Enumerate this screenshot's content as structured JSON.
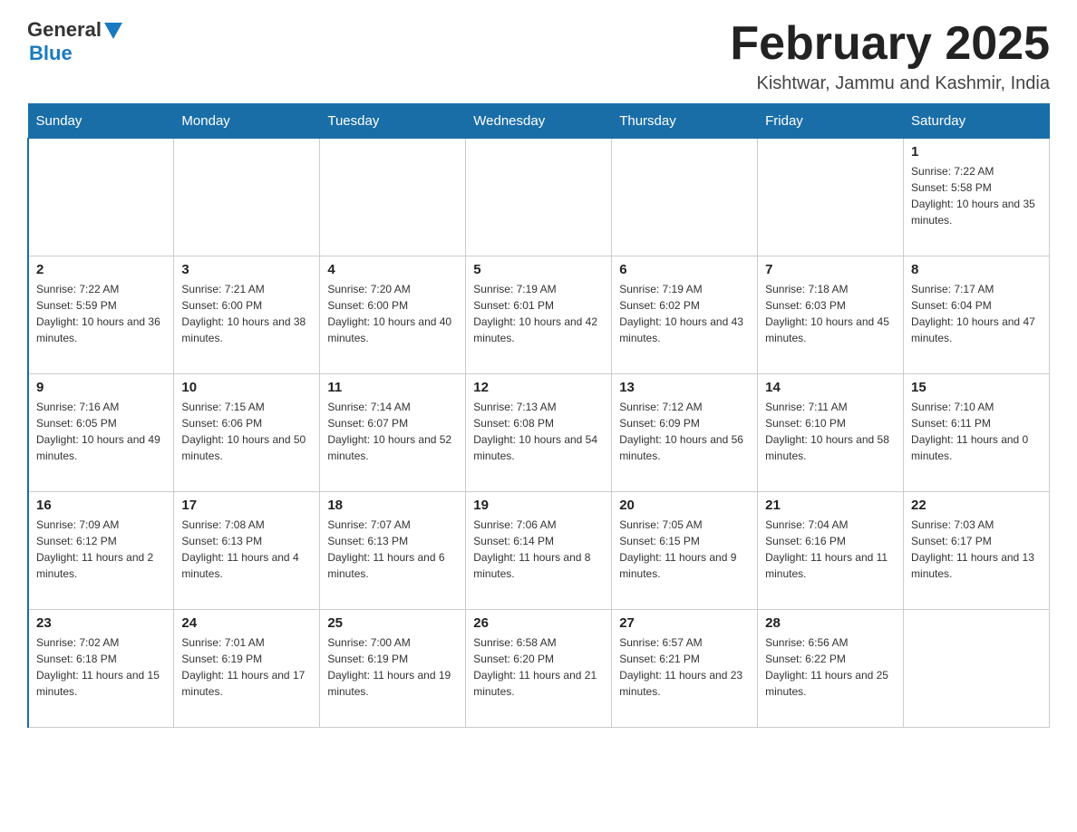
{
  "logo": {
    "general": "General",
    "blue": "Blue"
  },
  "title": "February 2025",
  "location": "Kishtwar, Jammu and Kashmir, India",
  "days_of_week": [
    "Sunday",
    "Monday",
    "Tuesday",
    "Wednesday",
    "Thursday",
    "Friday",
    "Saturday"
  ],
  "weeks": [
    [
      {
        "day": "",
        "info": ""
      },
      {
        "day": "",
        "info": ""
      },
      {
        "day": "",
        "info": ""
      },
      {
        "day": "",
        "info": ""
      },
      {
        "day": "",
        "info": ""
      },
      {
        "day": "",
        "info": ""
      },
      {
        "day": "1",
        "info": "Sunrise: 7:22 AM\nSunset: 5:58 PM\nDaylight: 10 hours and 35 minutes."
      }
    ],
    [
      {
        "day": "2",
        "info": "Sunrise: 7:22 AM\nSunset: 5:59 PM\nDaylight: 10 hours and 36 minutes."
      },
      {
        "day": "3",
        "info": "Sunrise: 7:21 AM\nSunset: 6:00 PM\nDaylight: 10 hours and 38 minutes."
      },
      {
        "day": "4",
        "info": "Sunrise: 7:20 AM\nSunset: 6:00 PM\nDaylight: 10 hours and 40 minutes."
      },
      {
        "day": "5",
        "info": "Sunrise: 7:19 AM\nSunset: 6:01 PM\nDaylight: 10 hours and 42 minutes."
      },
      {
        "day": "6",
        "info": "Sunrise: 7:19 AM\nSunset: 6:02 PM\nDaylight: 10 hours and 43 minutes."
      },
      {
        "day": "7",
        "info": "Sunrise: 7:18 AM\nSunset: 6:03 PM\nDaylight: 10 hours and 45 minutes."
      },
      {
        "day": "8",
        "info": "Sunrise: 7:17 AM\nSunset: 6:04 PM\nDaylight: 10 hours and 47 minutes."
      }
    ],
    [
      {
        "day": "9",
        "info": "Sunrise: 7:16 AM\nSunset: 6:05 PM\nDaylight: 10 hours and 49 minutes."
      },
      {
        "day": "10",
        "info": "Sunrise: 7:15 AM\nSunset: 6:06 PM\nDaylight: 10 hours and 50 minutes."
      },
      {
        "day": "11",
        "info": "Sunrise: 7:14 AM\nSunset: 6:07 PM\nDaylight: 10 hours and 52 minutes."
      },
      {
        "day": "12",
        "info": "Sunrise: 7:13 AM\nSunset: 6:08 PM\nDaylight: 10 hours and 54 minutes."
      },
      {
        "day": "13",
        "info": "Sunrise: 7:12 AM\nSunset: 6:09 PM\nDaylight: 10 hours and 56 minutes."
      },
      {
        "day": "14",
        "info": "Sunrise: 7:11 AM\nSunset: 6:10 PM\nDaylight: 10 hours and 58 minutes."
      },
      {
        "day": "15",
        "info": "Sunrise: 7:10 AM\nSunset: 6:11 PM\nDaylight: 11 hours and 0 minutes."
      }
    ],
    [
      {
        "day": "16",
        "info": "Sunrise: 7:09 AM\nSunset: 6:12 PM\nDaylight: 11 hours and 2 minutes."
      },
      {
        "day": "17",
        "info": "Sunrise: 7:08 AM\nSunset: 6:13 PM\nDaylight: 11 hours and 4 minutes."
      },
      {
        "day": "18",
        "info": "Sunrise: 7:07 AM\nSunset: 6:13 PM\nDaylight: 11 hours and 6 minutes."
      },
      {
        "day": "19",
        "info": "Sunrise: 7:06 AM\nSunset: 6:14 PM\nDaylight: 11 hours and 8 minutes."
      },
      {
        "day": "20",
        "info": "Sunrise: 7:05 AM\nSunset: 6:15 PM\nDaylight: 11 hours and 9 minutes."
      },
      {
        "day": "21",
        "info": "Sunrise: 7:04 AM\nSunset: 6:16 PM\nDaylight: 11 hours and 11 minutes."
      },
      {
        "day": "22",
        "info": "Sunrise: 7:03 AM\nSunset: 6:17 PM\nDaylight: 11 hours and 13 minutes."
      }
    ],
    [
      {
        "day": "23",
        "info": "Sunrise: 7:02 AM\nSunset: 6:18 PM\nDaylight: 11 hours and 15 minutes."
      },
      {
        "day": "24",
        "info": "Sunrise: 7:01 AM\nSunset: 6:19 PM\nDaylight: 11 hours and 17 minutes."
      },
      {
        "day": "25",
        "info": "Sunrise: 7:00 AM\nSunset: 6:19 PM\nDaylight: 11 hours and 19 minutes."
      },
      {
        "day": "26",
        "info": "Sunrise: 6:58 AM\nSunset: 6:20 PM\nDaylight: 11 hours and 21 minutes."
      },
      {
        "day": "27",
        "info": "Sunrise: 6:57 AM\nSunset: 6:21 PM\nDaylight: 11 hours and 23 minutes."
      },
      {
        "day": "28",
        "info": "Sunrise: 6:56 AM\nSunset: 6:22 PM\nDaylight: 11 hours and 25 minutes."
      },
      {
        "day": "",
        "info": ""
      }
    ]
  ]
}
